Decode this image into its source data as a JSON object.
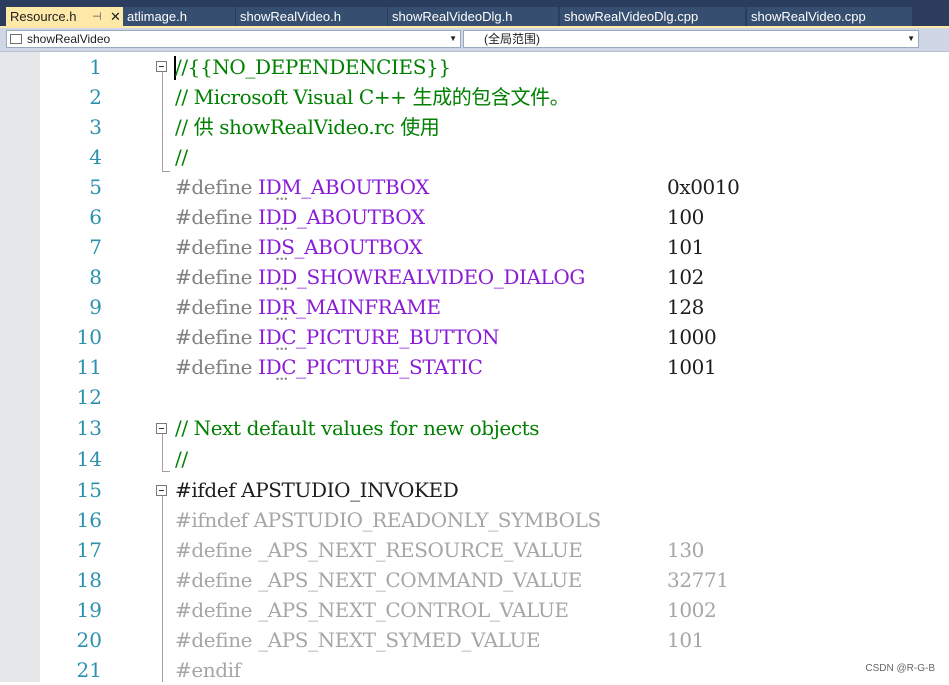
{
  "tabs": [
    {
      "label": "Resource.h",
      "active": true,
      "pin": "⊣",
      "close": "✕"
    },
    {
      "label": "atlimage.h"
    },
    {
      "label": "showRealVideo.h"
    },
    {
      "label": "showRealVideoDlg.h"
    },
    {
      "label": "showRealVideoDlg.cpp"
    },
    {
      "label": "showRealVideo.cpp"
    }
  ],
  "navbar": {
    "project": "showRealVideo",
    "scope": "(全局范围)"
  },
  "editor": {
    "lines": [
      {
        "n": "1",
        "text": "//{{NO_DEPENDENCIES}}",
        "kind": "comment"
      },
      {
        "n": "2",
        "text": "// Microsoft Visual C++ 生成的包含文件。",
        "kind": "comment"
      },
      {
        "n": "3",
        "text": "// 供 showRealVideo.rc 使用",
        "kind": "comment"
      },
      {
        "n": "4",
        "text": "//",
        "kind": "comment"
      },
      {
        "n": "5",
        "directive": "#define ",
        "macro": "IDM_ABOUTBOX",
        "value": "0x0010"
      },
      {
        "n": "6",
        "directive": "#define ",
        "macro": "IDD_ABOUTBOX",
        "value": "100"
      },
      {
        "n": "7",
        "directive": "#define ",
        "macro": "IDS_ABOUTBOX",
        "value": "101"
      },
      {
        "n": "8",
        "directive": "#define ",
        "macro": "IDD_SHOWREALVIDEO_DIALOG",
        "value": "102"
      },
      {
        "n": "9",
        "directive": "#define ",
        "macro": "IDR_MAINFRAME",
        "value": "128"
      },
      {
        "n": "10",
        "directive": "#define ",
        "macro": "IDC_PICTURE_BUTTON",
        "value": "1000"
      },
      {
        "n": "11",
        "directive": "#define ",
        "macro": "IDC_PICTURE_STATIC",
        "value": "1001"
      },
      {
        "n": "12",
        "text": ""
      },
      {
        "n": "13",
        "text": "// Next default values for new objects",
        "kind": "comment"
      },
      {
        "n": "14",
        "text": "//",
        "kind": "comment"
      },
      {
        "n": "15",
        "directive": "#ifdef ",
        "rest": "APSTUDIO_INVOKED"
      },
      {
        "n": "16",
        "text": "#ifndef APSTUDIO_READONLY_SYMBOLS",
        "kind": "inactive"
      },
      {
        "n": "17",
        "directive": "#define _APS_NEXT_RESOURCE_VALUE",
        "value": "130",
        "inactive": true
      },
      {
        "n": "18",
        "directive": "#define _APS_NEXT_COMMAND_VALUE",
        "value": "32771",
        "inactive": true
      },
      {
        "n": "19",
        "directive": "#define _APS_NEXT_CONTROL_VALUE",
        "value": "1002",
        "inactive": true
      },
      {
        "n": "20",
        "directive": "#define _APS_NEXT_SYMED_VALUE",
        "value": "101",
        "inactive": true
      },
      {
        "n": "21",
        "text": "#endif",
        "kind": "inactive"
      }
    ]
  },
  "watermark": "CSDN @R-G-B",
  "colors": {
    "tabbar": "#2b3c5c",
    "active_tab": "#ffe9a8",
    "comment": "#008000",
    "macro": "#8a1bd6",
    "line_number": "#2b91af",
    "inactive": "#a6a6a6"
  }
}
